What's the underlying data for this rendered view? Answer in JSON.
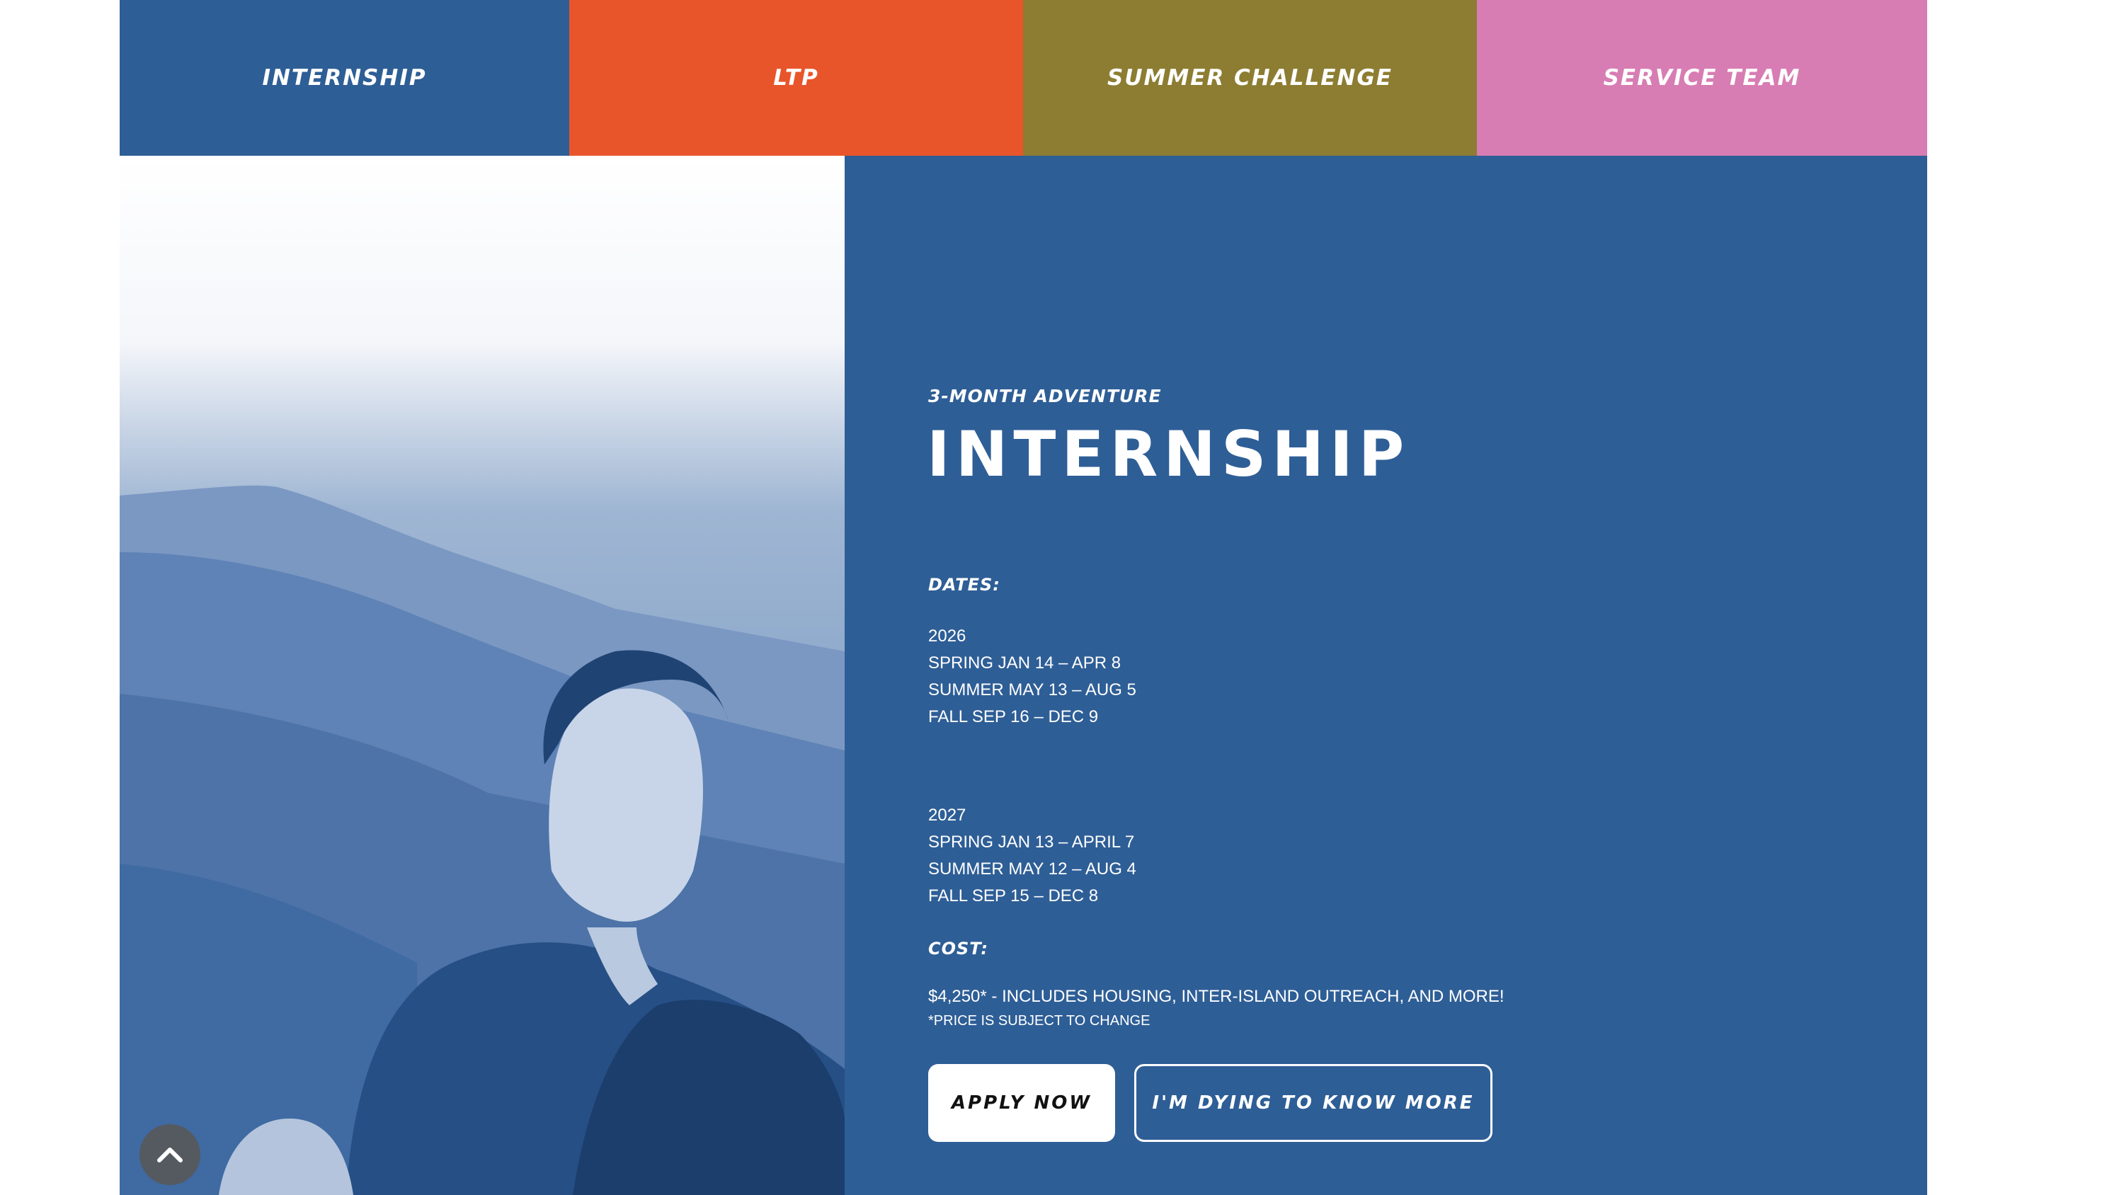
{
  "nav": {
    "tabs": [
      {
        "label": "INTERNSHIP",
        "color": "#2e5e96"
      },
      {
        "label": "LTP",
        "color": "#e8552b"
      },
      {
        "label": "SUMMER CHALLENGE",
        "color": "#8c7d32"
      },
      {
        "label": "SERVICE TEAM",
        "color": "#d77db3"
      }
    ]
  },
  "program": {
    "eyebrow": "3-MONTH ADVENTURE",
    "title": "INTERNSHIP",
    "accent_color": "#2e5e96",
    "dates_label": "DATES:",
    "dates": {
      "y2026": {
        "year": "2026",
        "spring": "SPRING JAN 14 – APR 8",
        "summer": "SUMMER MAY 13 – AUG 5",
        "fall": "FALL SEP 16 – DEC 9"
      },
      "y2027": {
        "year": "2027",
        "spring": "SPRING JAN 13 – APRIL 7",
        "summer": "SUMMER MAY 12 – AUG 4",
        "fall": "FALL SEP 15 – DEC 8"
      }
    },
    "cost_label": "COST:",
    "cost_text": "$4,250* - INCLUDES HOUSING, INTER-ISLAND OUTREACH, AND MORE!",
    "cost_note": "*PRICE IS SUBJECT TO CHANGE"
  },
  "actions": {
    "apply_label": "APPLY NOW",
    "more_label": "I'M DYING TO KNOW MORE"
  },
  "icons": {
    "scroll_top": "chevron-up-icon"
  }
}
